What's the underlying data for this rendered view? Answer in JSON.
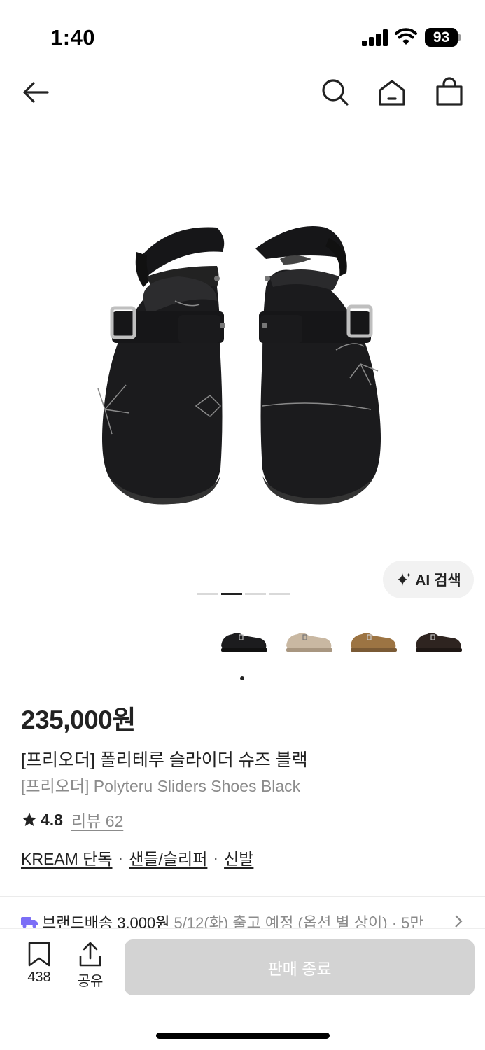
{
  "status_bar": {
    "time": "1:40",
    "battery": "93"
  },
  "nav": {
    "icons": [
      "back-arrow-icon",
      "search-icon",
      "home-icon",
      "shopping-bag-icon"
    ]
  },
  "ai_search": {
    "label": "AI 검색",
    "icon": "sparkle-icon"
  },
  "gallery": {
    "total_images": 4,
    "active_index": 1,
    "colors": [
      "black",
      "beige",
      "brown",
      "dark-brown"
    ]
  },
  "product": {
    "price": "235,000원",
    "title_ko": "[프리오더] 폴리테루 슬라이더 슈즈 블랙",
    "title_en": "[프리오더] Polyteru Sliders Shoes Black",
    "rating": "4.8",
    "review_label": "리뷰 62",
    "tags": [
      "KREAM 단독",
      "샌들/슬리퍼",
      "신발"
    ]
  },
  "shipping": {
    "label": "브랜드배송",
    "fee": "3,000원",
    "detail": "5/12(화) 출고 예정 (옵션 별 상이) · 5만"
  },
  "bottom_bar": {
    "wish_count": "438",
    "share_label": "공유",
    "sold_out_label": "판매 종료"
  },
  "colors": {
    "accent": "#222222",
    "muted_text": "#8b8b8b",
    "disabled_button": "#d3d3d3",
    "truck": "#7b6ef6"
  }
}
